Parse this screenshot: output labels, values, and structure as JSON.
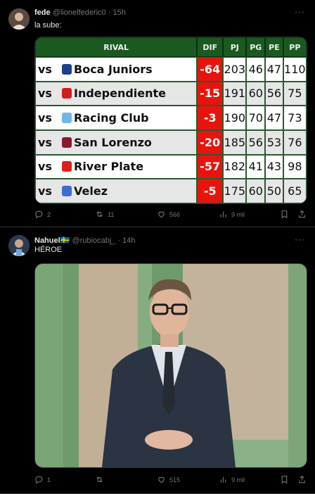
{
  "tweet1": {
    "display_name": "fede",
    "handle": "@lionelfederic0",
    "dot": "·",
    "time": "15h",
    "text": "la sube:",
    "more_icon": "more-icon",
    "table": {
      "headers": [
        "RIVAL",
        "DIF",
        "PJ",
        "PG",
        "PE",
        "PP"
      ],
      "rows": [
        {
          "vs": "vs",
          "rival": "Boca Juniors",
          "crest_color": "#1c3f8f",
          "dif": "-64",
          "pj": "203",
          "pg": "46",
          "pe": "47",
          "pp": "110"
        },
        {
          "vs": "vs",
          "rival": "Independiente",
          "crest_color": "#d11c1c",
          "dif": "-15",
          "pj": "191",
          "pg": "60",
          "pe": "56",
          "pp": "75"
        },
        {
          "vs": "vs",
          "rival": "Racing Club",
          "crest_color": "#6fb6e8",
          "dif": "-3",
          "pj": "190",
          "pg": "70",
          "pe": "47",
          "pp": "73"
        },
        {
          "vs": "vs",
          "rival": "San Lorenzo",
          "crest_color": "#8a1b2e",
          "dif": "-20",
          "pj": "185",
          "pg": "56",
          "pe": "53",
          "pp": "76"
        },
        {
          "vs": "vs",
          "rival": "River Plate",
          "crest_color": "#e01e1e",
          "dif": "-57",
          "pj": "182",
          "pg": "41",
          "pe": "43",
          "pp": "98"
        },
        {
          "vs": "vs",
          "rival": "Velez",
          "crest_color": "#3a6fd0",
          "dif": "-5",
          "pj": "175",
          "pg": "60",
          "pe": "50",
          "pp": "65"
        }
      ]
    },
    "actions": {
      "replies": "2",
      "retweets": "11",
      "likes": "566",
      "views": "9 mil"
    }
  },
  "tweet2": {
    "display_name": "Nahuel",
    "flag": "🇸🇪",
    "handle": "@rubiocabj_",
    "dot": "·",
    "time": "14h",
    "text": "HÉROE",
    "actions": {
      "replies": "1",
      "retweets": "",
      "likes": "515",
      "views": "9 mil"
    }
  },
  "colors": {
    "background": "#000000",
    "muted": "#71767b",
    "dif_red": "#e8140c",
    "table_header": "#1a5a20"
  }
}
